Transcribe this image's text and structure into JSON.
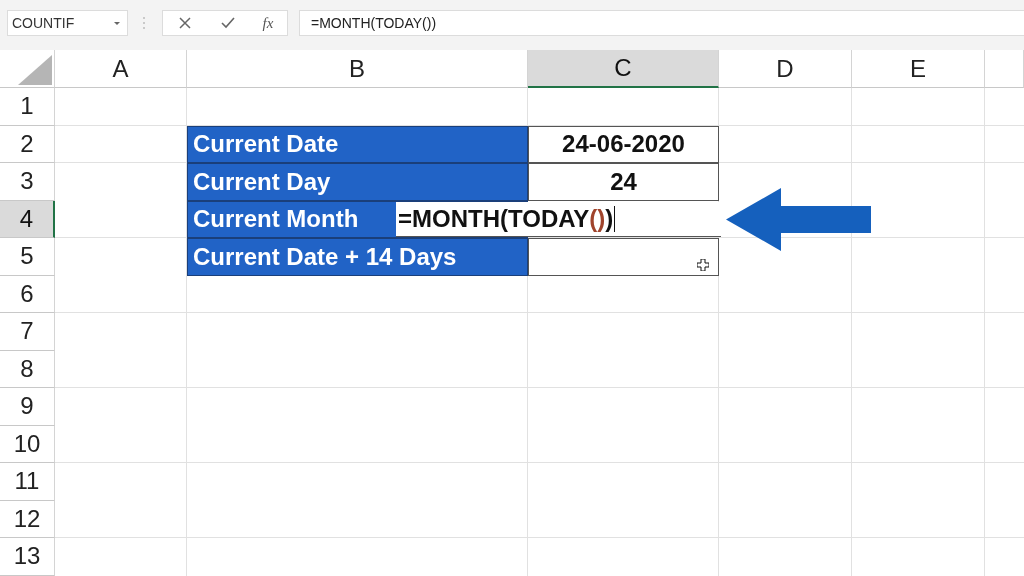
{
  "formula_bar": {
    "name_box": "COUNTIF",
    "function_button": "fx",
    "formula": "=MONTH(TODAY())"
  },
  "columns": [
    {
      "label": "A",
      "selected": false
    },
    {
      "label": "B",
      "selected": false
    },
    {
      "label": "C",
      "selected": true
    },
    {
      "label": "D",
      "selected": false
    },
    {
      "label": "E",
      "selected": false
    }
  ],
  "rows": [
    {
      "label": "1",
      "selected": false
    },
    {
      "label": "2",
      "selected": false,
      "column_b": "Current Date",
      "column_c": {
        "kind": "value",
        "text": "24-06-2020"
      }
    },
    {
      "label": "3",
      "selected": false,
      "column_b": "Current Day",
      "column_c": {
        "kind": "value",
        "text": "24"
      }
    },
    {
      "label": "4",
      "selected": true,
      "column_b": "Current Month",
      "column_c": {
        "kind": "editing",
        "parts": [
          {
            "kind": "plain",
            "text": "=MONTH(TODAY"
          },
          {
            "kind": "paren",
            "text": "()"
          },
          {
            "kind": "plain",
            "text": ")"
          }
        ]
      }
    },
    {
      "label": "5",
      "selected": false,
      "column_b": "Current Date + 14 Days",
      "column_c": {
        "kind": "pointer"
      }
    },
    {
      "label": "6",
      "selected": false
    },
    {
      "label": "7",
      "selected": false
    },
    {
      "label": "8",
      "selected": false
    },
    {
      "label": "9",
      "selected": false
    },
    {
      "label": "10",
      "selected": false
    },
    {
      "label": "11",
      "selected": false
    },
    {
      "label": "12",
      "selected": false
    },
    {
      "label": "13",
      "selected": false
    }
  ]
}
